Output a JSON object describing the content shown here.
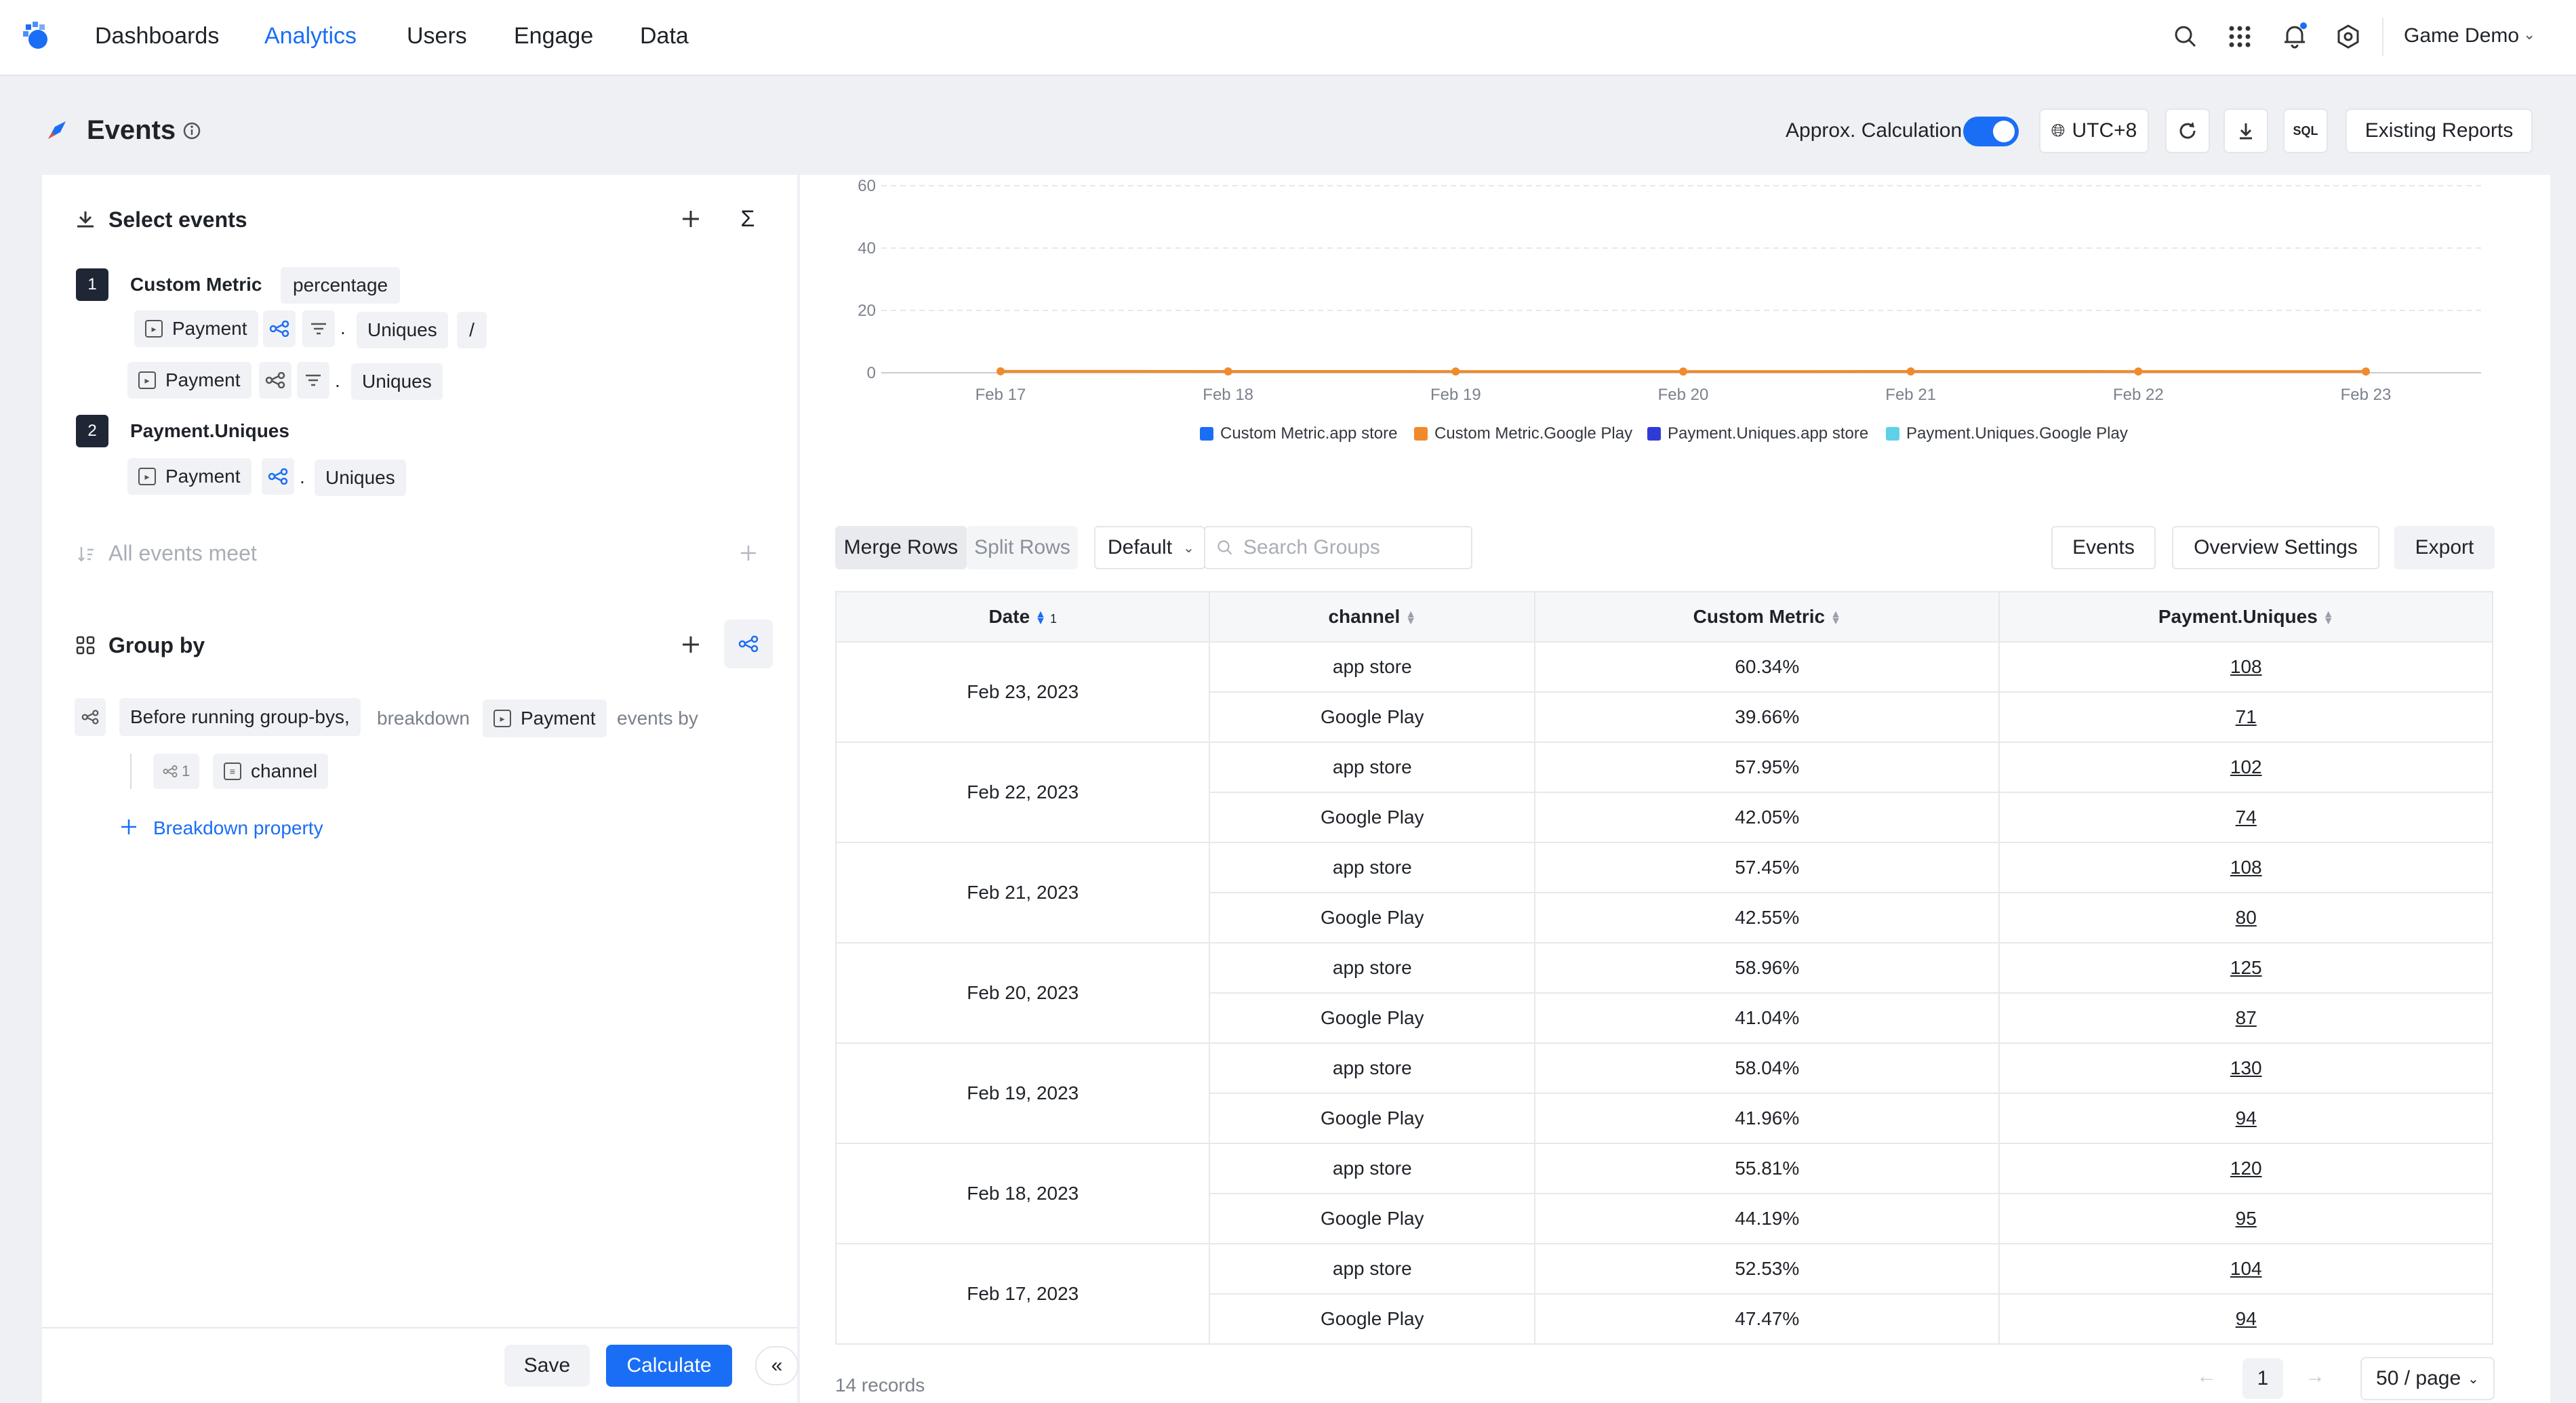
{
  "nav": {
    "items": [
      "Dashboards",
      "Analytics",
      "Users",
      "Engage",
      "Data"
    ],
    "active": "Analytics",
    "project": "Game Demo"
  },
  "header": {
    "title": "Events",
    "approx_label": "Approx. Calculation",
    "timezone": "UTC+8",
    "sql_label": "SQL",
    "existing_reports": "Existing Reports"
  },
  "left": {
    "select_events_title": "Select events",
    "metric1": {
      "index": "1",
      "name": "Custom Metric",
      "format": "percentage",
      "line1": {
        "event": "Payment",
        "dot": ".",
        "measure": "Uniques",
        "op": "/"
      },
      "line2": {
        "event": "Payment",
        "dot": ".",
        "measure": "Uniques"
      }
    },
    "metric2": {
      "index": "2",
      "name": "Payment.Uniques",
      "line1": {
        "event": "Payment",
        "dot": ".",
        "measure": "Uniques"
      }
    },
    "all_events_meet": "All events meet",
    "group_by_title": "Group by",
    "before_label": "Before running group-bys,",
    "breakdown_label": "breakdown",
    "breakdown_event": "Payment",
    "events_by": "events by",
    "group_index": "1",
    "group_property": "channel",
    "add_breakdown": "Breakdown property",
    "save": "Save",
    "calculate": "Calculate"
  },
  "chart_data": {
    "type": "line",
    "x": [
      "Feb 17",
      "Feb 18",
      "Feb 19",
      "Feb 20",
      "Feb 21",
      "Feb 22",
      "Feb 23"
    ],
    "yticks": [
      "60",
      "40",
      "20",
      "0"
    ],
    "ylim": [
      0,
      60
    ],
    "series": [
      {
        "name": "Custom Metric.app store",
        "color": "#1a6ef5",
        "values": [
          0.5253,
          0.5581,
          0.5804,
          0.5896,
          0.5745,
          0.5795,
          0.6034
        ]
      },
      {
        "name": "Custom Metric.Google Play",
        "color": "#f08a2c",
        "values": [
          0.4747,
          0.4419,
          0.4196,
          0.4104,
          0.4255,
          0.4205,
          0.3966
        ]
      },
      {
        "name": "Payment.Uniques.app store",
        "color": "#2f3bd6",
        "values": [
          104,
          120,
          130,
          125,
          108,
          102,
          108
        ]
      },
      {
        "name": "Payment.Uniques.Google Play",
        "color": "#5fd0e8",
        "values": [
          94,
          95,
          94,
          87,
          80,
          74,
          71
        ]
      }
    ]
  },
  "toolbar": {
    "merge_rows": "Merge Rows",
    "split_rows": "Split Rows",
    "default": "Default",
    "search_placeholder": "Search Groups",
    "events": "Events",
    "overview_settings": "Overview Settings",
    "export": "Export"
  },
  "table": {
    "columns": [
      "Date",
      "channel",
      "Custom Metric",
      "Payment.Uniques"
    ],
    "date_sort_index": "1",
    "groups": [
      {
        "date": "Feb 23, 2023",
        "rows": [
          {
            "channel": "app store",
            "metric": "60.34%",
            "uniques": "108"
          },
          {
            "channel": "Google Play",
            "metric": "39.66%",
            "uniques": "71"
          }
        ]
      },
      {
        "date": "Feb 22, 2023",
        "rows": [
          {
            "channel": "app store",
            "metric": "57.95%",
            "uniques": "102"
          },
          {
            "channel": "Google Play",
            "metric": "42.05%",
            "uniques": "74"
          }
        ]
      },
      {
        "date": "Feb 21, 2023",
        "rows": [
          {
            "channel": "app store",
            "metric": "57.45%",
            "uniques": "108"
          },
          {
            "channel": "Google Play",
            "metric": "42.55%",
            "uniques": "80"
          }
        ]
      },
      {
        "date": "Feb 20, 2023",
        "rows": [
          {
            "channel": "app store",
            "metric": "58.96%",
            "uniques": "125"
          },
          {
            "channel": "Google Play",
            "metric": "41.04%",
            "uniques": "87"
          }
        ]
      },
      {
        "date": "Feb 19, 2023",
        "rows": [
          {
            "channel": "app store",
            "metric": "58.04%",
            "uniques": "130"
          },
          {
            "channel": "Google Play",
            "metric": "41.96%",
            "uniques": "94"
          }
        ]
      },
      {
        "date": "Feb 18, 2023",
        "rows": [
          {
            "channel": "app store",
            "metric": "55.81%",
            "uniques": "120"
          },
          {
            "channel": "Google Play",
            "metric": "44.19%",
            "uniques": "95"
          }
        ]
      },
      {
        "date": "Feb 17, 2023",
        "rows": [
          {
            "channel": "app store",
            "metric": "52.53%",
            "uniques": "104"
          },
          {
            "channel": "Google Play",
            "metric": "47.47%",
            "uniques": "94"
          }
        ]
      }
    ]
  },
  "footer": {
    "records": "14 records",
    "page": "1",
    "page_size": "50 / page"
  }
}
